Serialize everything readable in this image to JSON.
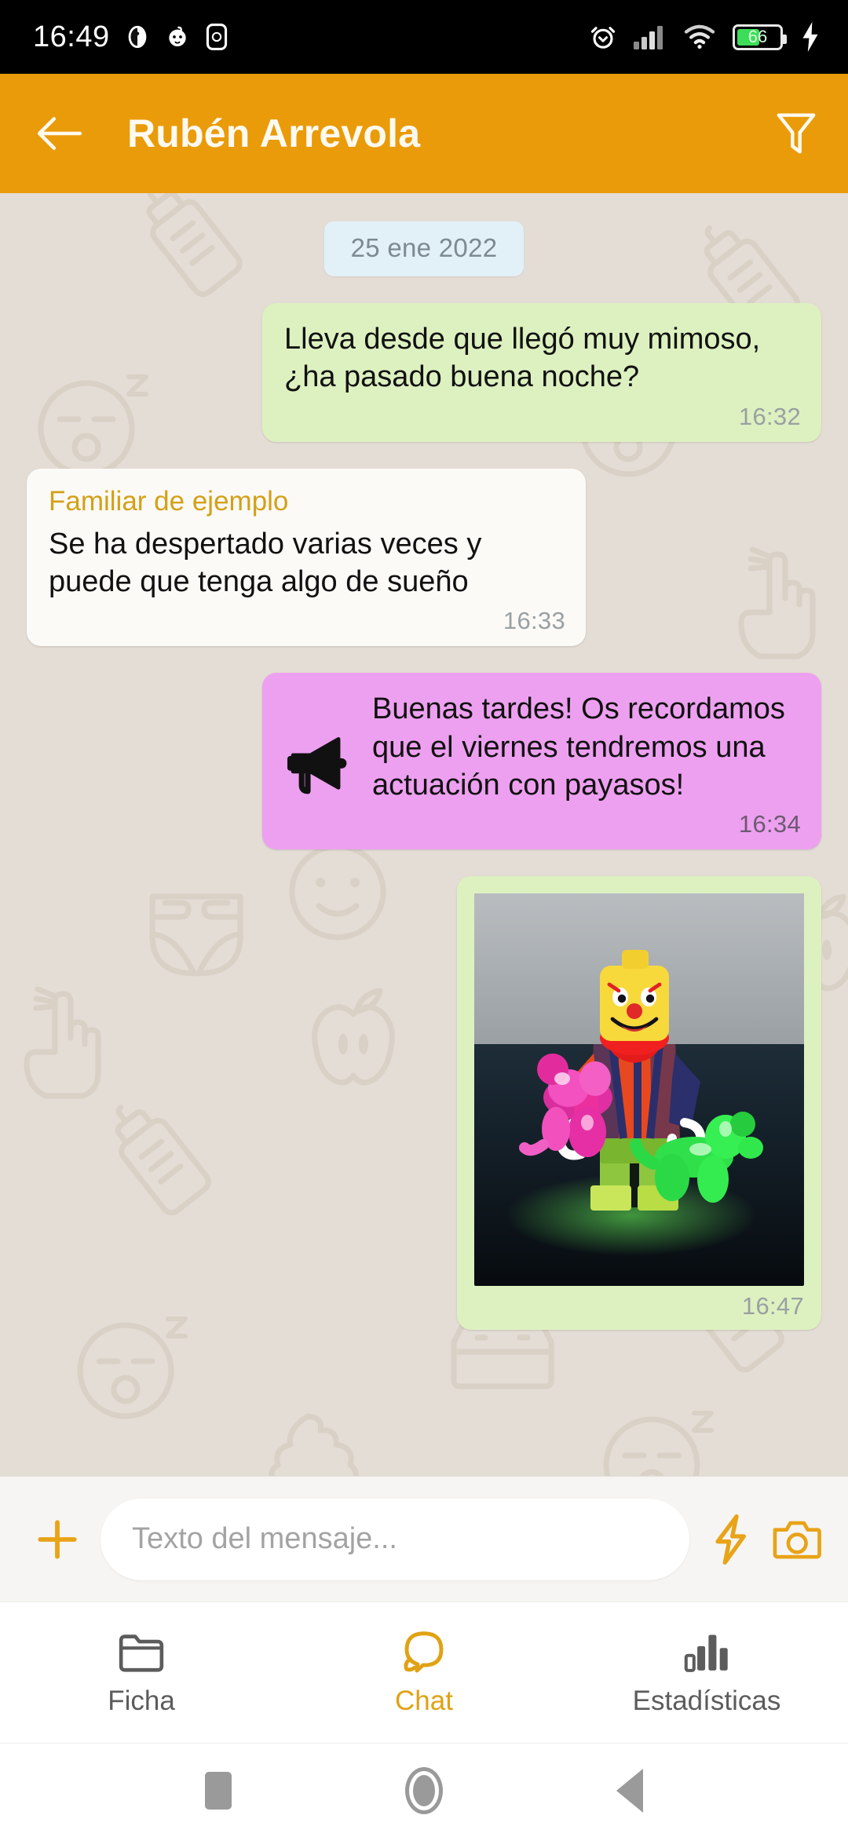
{
  "status_bar": {
    "time": "16:49",
    "battery_percent": "66",
    "icons": [
      "clock-face-icon",
      "baby-face-icon",
      "app-badge-icon",
      "alarm-icon",
      "signal-icon",
      "wifi-icon",
      "battery-icon",
      "charging-bolt-icon"
    ]
  },
  "header": {
    "title": "Rubén Arrevola",
    "back_icon": "back-arrow-icon",
    "filter_icon": "filter-funnel-icon",
    "background_color": "#ea9b09"
  },
  "chat": {
    "date_separator": "25 ene 2022",
    "background_color": "#e4ddd5",
    "messages": [
      {
        "id": "msg-1",
        "direction": "outgoing",
        "kind": "text",
        "sender": "",
        "text": "Lleva desde que llegó muy mimoso, ¿ha pasado buena noche?",
        "time": "16:32",
        "bubble_color": "#ddf1c0"
      },
      {
        "id": "msg-2",
        "direction": "incoming",
        "kind": "text",
        "sender": "Familiar de ejemplo",
        "text": "Se ha despertado varias veces y puede que tenga algo de sueño",
        "time": "16:33",
        "bubble_color": "#fbfaf7"
      },
      {
        "id": "msg-3",
        "direction": "outgoing",
        "kind": "announcement",
        "sender": "",
        "icon": "megaphone-icon",
        "text": "Buenas tardes! Os recordamos que el viernes tendremos una actuación con payasos!",
        "time": "16:34",
        "bubble_color": "#eda0f0"
      },
      {
        "id": "msg-4",
        "direction": "outgoing",
        "kind": "image",
        "sender": "",
        "image_alt": "Figura LEGO de payaso con globos de animales rosa y verde",
        "time": "16:47",
        "bubble_color": "#ddf1c0"
      }
    ],
    "wallpaper_icons": [
      "baby-bottle-icon",
      "sleeping-face-icon",
      "diaper-icon",
      "pointing-hand-icon",
      "apple-icon",
      "tissue-box-icon",
      "poop-icon",
      "smiley-face-icon"
    ]
  },
  "composer": {
    "add_icon": "plus-icon",
    "placeholder": "Texto del mensaje...",
    "value": "",
    "quick_icon": "lightning-bolt-icon",
    "camera_icon": "camera-icon",
    "accent_color": "#e8a317"
  },
  "bottom_nav": {
    "active": "Chat",
    "items": [
      {
        "label": "Ficha",
        "icon": "folder-icon",
        "active": false
      },
      {
        "label": "Chat",
        "icon": "chat-bubble-icon",
        "active": true
      },
      {
        "label": "Estadísticas",
        "icon": "bar-chart-icon",
        "active": false
      }
    ]
  },
  "system_nav": {
    "recents_icon": "square-recents-icon",
    "home_icon": "circle-home-icon",
    "back_icon": "triangle-back-icon"
  }
}
